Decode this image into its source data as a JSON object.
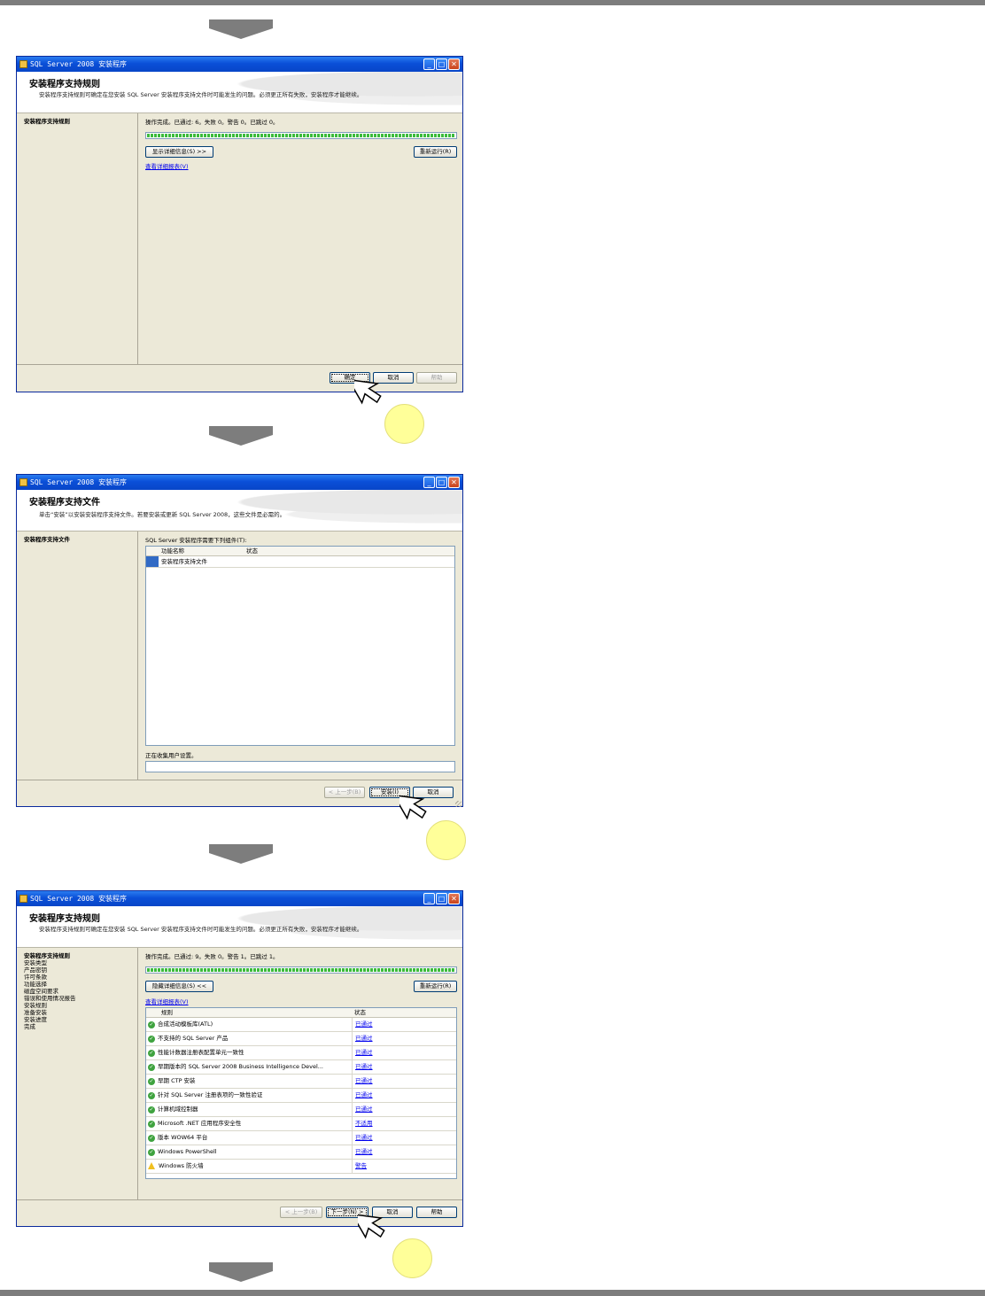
{
  "window_title": "SQL Server 2008 安装程序",
  "dialogs": [
    {
      "header_title": "安装程序支持规则",
      "header_desc": "安装程序支持规则可确定在您安装 SQL Server 安装程序支持文件时可能发生的问题。必须更正所有失败，安装程序才能继续。",
      "nav": [
        "安装程序支持规则"
      ],
      "status": "操作完成。已通过: 6。失败 0。警告 0。已跳过 0。",
      "show_details": "显示详细信息(S) >>",
      "rerun": "重新运行(R)",
      "view_report": "查看详细报表(V)",
      "ok": "确定",
      "cancel": "取消",
      "help": "帮助"
    },
    {
      "header_title": "安装程序支持文件",
      "header_desc": "单击“安装”以安装安装程序支持文件。若要安装或更新 SQL Server 2008，这些文件是必需的。",
      "nav": [
        "安装程序支持文件"
      ],
      "components_label": "SQL Server 安装程序需要下列组件(T):",
      "col_feature": "功能名称",
      "col_status": "状态",
      "row_feature": "安装程序支持文件",
      "row_status": "",
      "progress_text": "正在收集用户设置。",
      "back": "< 上一步(B)",
      "install": "安装(I)",
      "cancel": "取消"
    },
    {
      "header_title": "安装程序支持规则",
      "header_desc": "安装程序支持规则可确定在您安装 SQL Server 安装程序支持文件时可能发生的问题。必须更正所有失败，安装程序才能继续。",
      "nav": [
        "安装程序支持规则",
        "安装类型",
        "产品密钥",
        "许可条款",
        "功能选择",
        "磁盘空间要求",
        "错误和使用情况报告",
        "安装规则",
        "准备安装",
        "安装进度",
        "完成"
      ],
      "status": "操作完成。已通过: 9。失败 0。警告 1。已跳过 1。",
      "hide_details": "隐藏详细信息(S) <<",
      "rerun": "重新运行(R)",
      "view_report": "查看详细报表(V)",
      "col_rule": "规则",
      "col_status": "状态",
      "rules": [
        {
          "name": "合成活动模板库(ATL)",
          "status": "已通过",
          "icon": "ok"
        },
        {
          "name": "不支持的 SQL Server 产品",
          "status": "已通过",
          "icon": "ok"
        },
        {
          "name": "性能计数器注册表配置单元一致性",
          "status": "已通过",
          "icon": "ok"
        },
        {
          "name": "早期版本的 SQL Server 2008 Business Intelligence Devel...",
          "status": "已通过",
          "icon": "ok"
        },
        {
          "name": "早期 CTP 安装",
          "status": "已通过",
          "icon": "ok"
        },
        {
          "name": "针对 SQL Server 注册表项的一致性验证",
          "status": "已通过",
          "icon": "ok"
        },
        {
          "name": "计算机域控制器",
          "status": "已通过",
          "icon": "ok"
        },
        {
          "name": "Microsoft .NET 应用程序安全性",
          "status": "不适用",
          "icon": "ok"
        },
        {
          "name": "版本 WOW64 平台",
          "status": "已通过",
          "icon": "ok"
        },
        {
          "name": "Windows PowerShell",
          "status": "已通过",
          "icon": "ok"
        },
        {
          "name": "Windows 防火墙",
          "status": "警告",
          "icon": "warning"
        }
      ],
      "back": "< 上一步(B)",
      "next": "下一步(N) >",
      "cancel": "取消",
      "help": "帮助"
    }
  ]
}
